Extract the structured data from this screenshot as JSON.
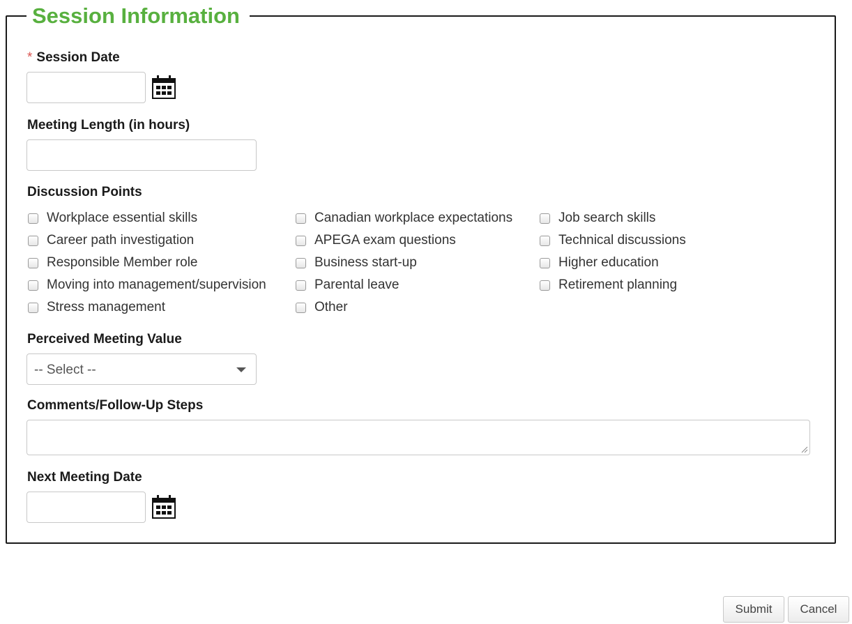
{
  "form": {
    "legend": "Session Information",
    "session_date": {
      "required_mark": "*",
      "label": "Session Date",
      "value": ""
    },
    "meeting_length": {
      "label": "Meeting Length (in hours)",
      "value": ""
    },
    "discussion_points": {
      "label": "Discussion Points",
      "col1": [
        "Workplace essential skills",
        "Career path investigation",
        "Responsible Member role",
        "Moving into management/supervision",
        "Stress management"
      ],
      "col2": [
        "Canadian workplace expectations",
        "APEGA exam questions",
        "Business start-up",
        "Parental leave",
        "Other"
      ],
      "col3": [
        "Job search skills",
        "Technical discussions",
        "Higher education",
        "Retirement planning"
      ]
    },
    "perceived_value": {
      "label": "Perceived Meeting Value",
      "selected": "-- Select --"
    },
    "comments": {
      "label": "Comments/Follow-Up Steps",
      "value": ""
    },
    "next_meeting_date": {
      "label": "Next Meeting Date",
      "value": ""
    }
  },
  "icons": {
    "calendar": "calendar-icon",
    "dropdown": "chevron-down-icon"
  },
  "buttons": {
    "submit": "Submit",
    "cancel": "Cancel"
  },
  "colors": {
    "legend": "#58b03f",
    "required": "#d9534f"
  }
}
